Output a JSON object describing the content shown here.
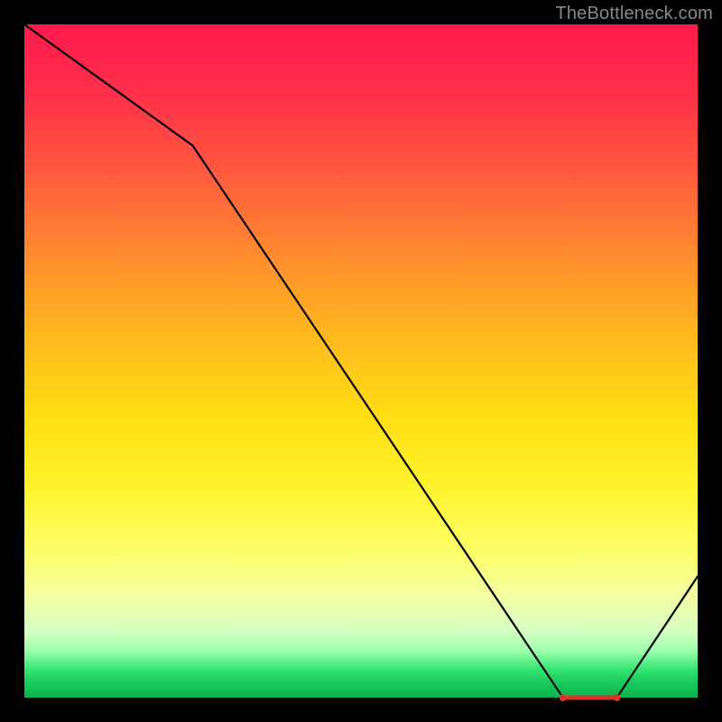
{
  "watermark": "TheBottleneck.com",
  "chart_data": {
    "type": "line",
    "title": "",
    "xlabel": "",
    "ylabel": "",
    "xlim": [
      0,
      100
    ],
    "ylim": [
      0,
      100
    ],
    "x": [
      0,
      25,
      80,
      88,
      100
    ],
    "values": [
      100,
      82,
      0,
      0,
      18
    ],
    "highlight_segment": {
      "x_start": 80,
      "x_end": 88,
      "y": 0
    }
  },
  "colors": {
    "background": "#000000",
    "line": "#000000",
    "highlight": "#d9352c",
    "watermark": "#888888"
  }
}
